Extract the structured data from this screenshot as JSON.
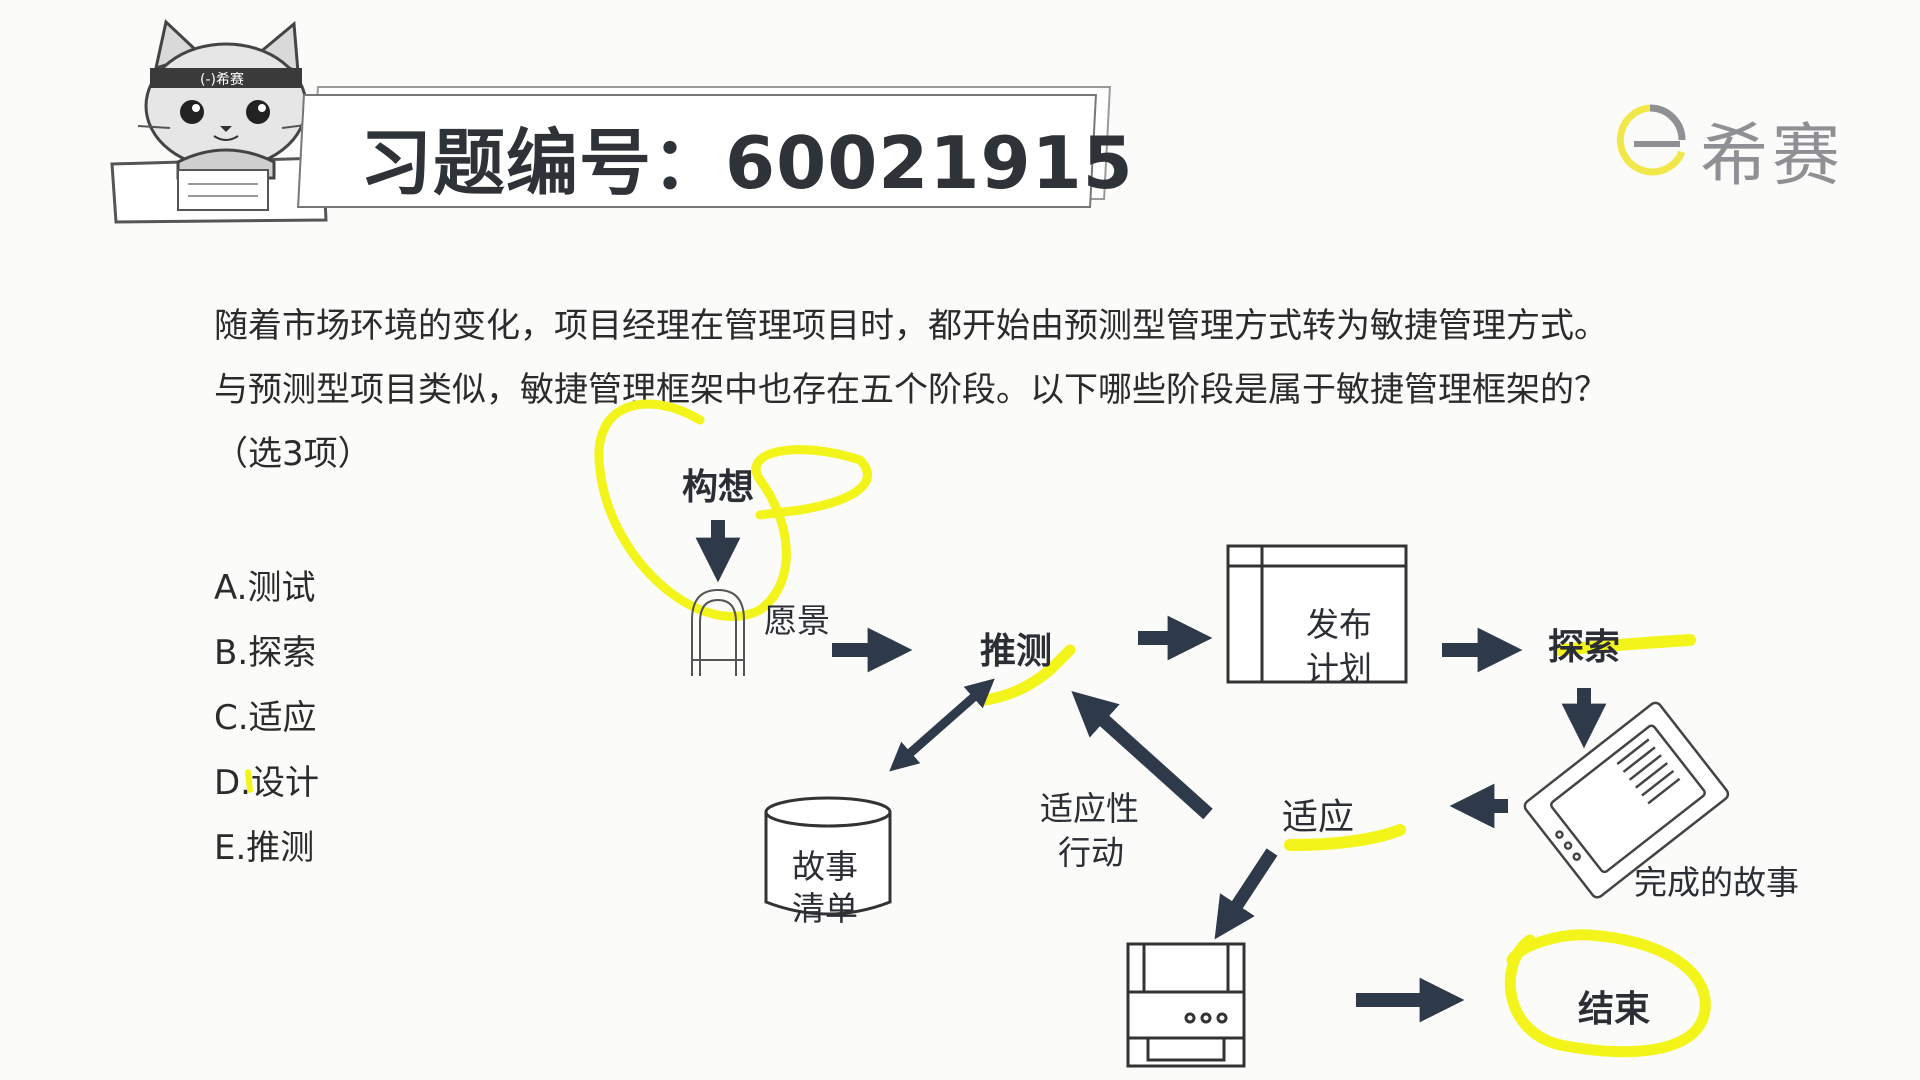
{
  "header": {
    "mascot_band_text": "(-)希赛",
    "title": "习题编号：60021915"
  },
  "logo": {
    "text": "希赛",
    "icon": "xisai-logo-icon"
  },
  "question": {
    "text": "随着市场环境的变化，项目经理在管理项目时，都开始由预测型管理方式转为敏捷管理方式。与预测型项目类似，敏捷管理框架中也存在五个阶段。以下哪些阶段是属于敏捷管理框架的？（选3项）",
    "options": [
      "A.测试",
      "B.探索",
      "C.适应",
      "D.设计",
      "E.推测"
    ]
  },
  "diagram": {
    "envision": "构想",
    "vision": "愿景",
    "speculate": "推测",
    "release_plan_line1": "发布",
    "release_plan_line2": "计划",
    "explore": "探索",
    "completed_stories": "完成的故事",
    "adapt": "适应",
    "adaptive_action_line1": "适应性",
    "adaptive_action_line2": "行动",
    "story_list_line1": "故事",
    "story_list_line2": "清单",
    "close": "结束",
    "highlight_color": "#f3f51a",
    "arrow_color": "#2e3a4a"
  }
}
